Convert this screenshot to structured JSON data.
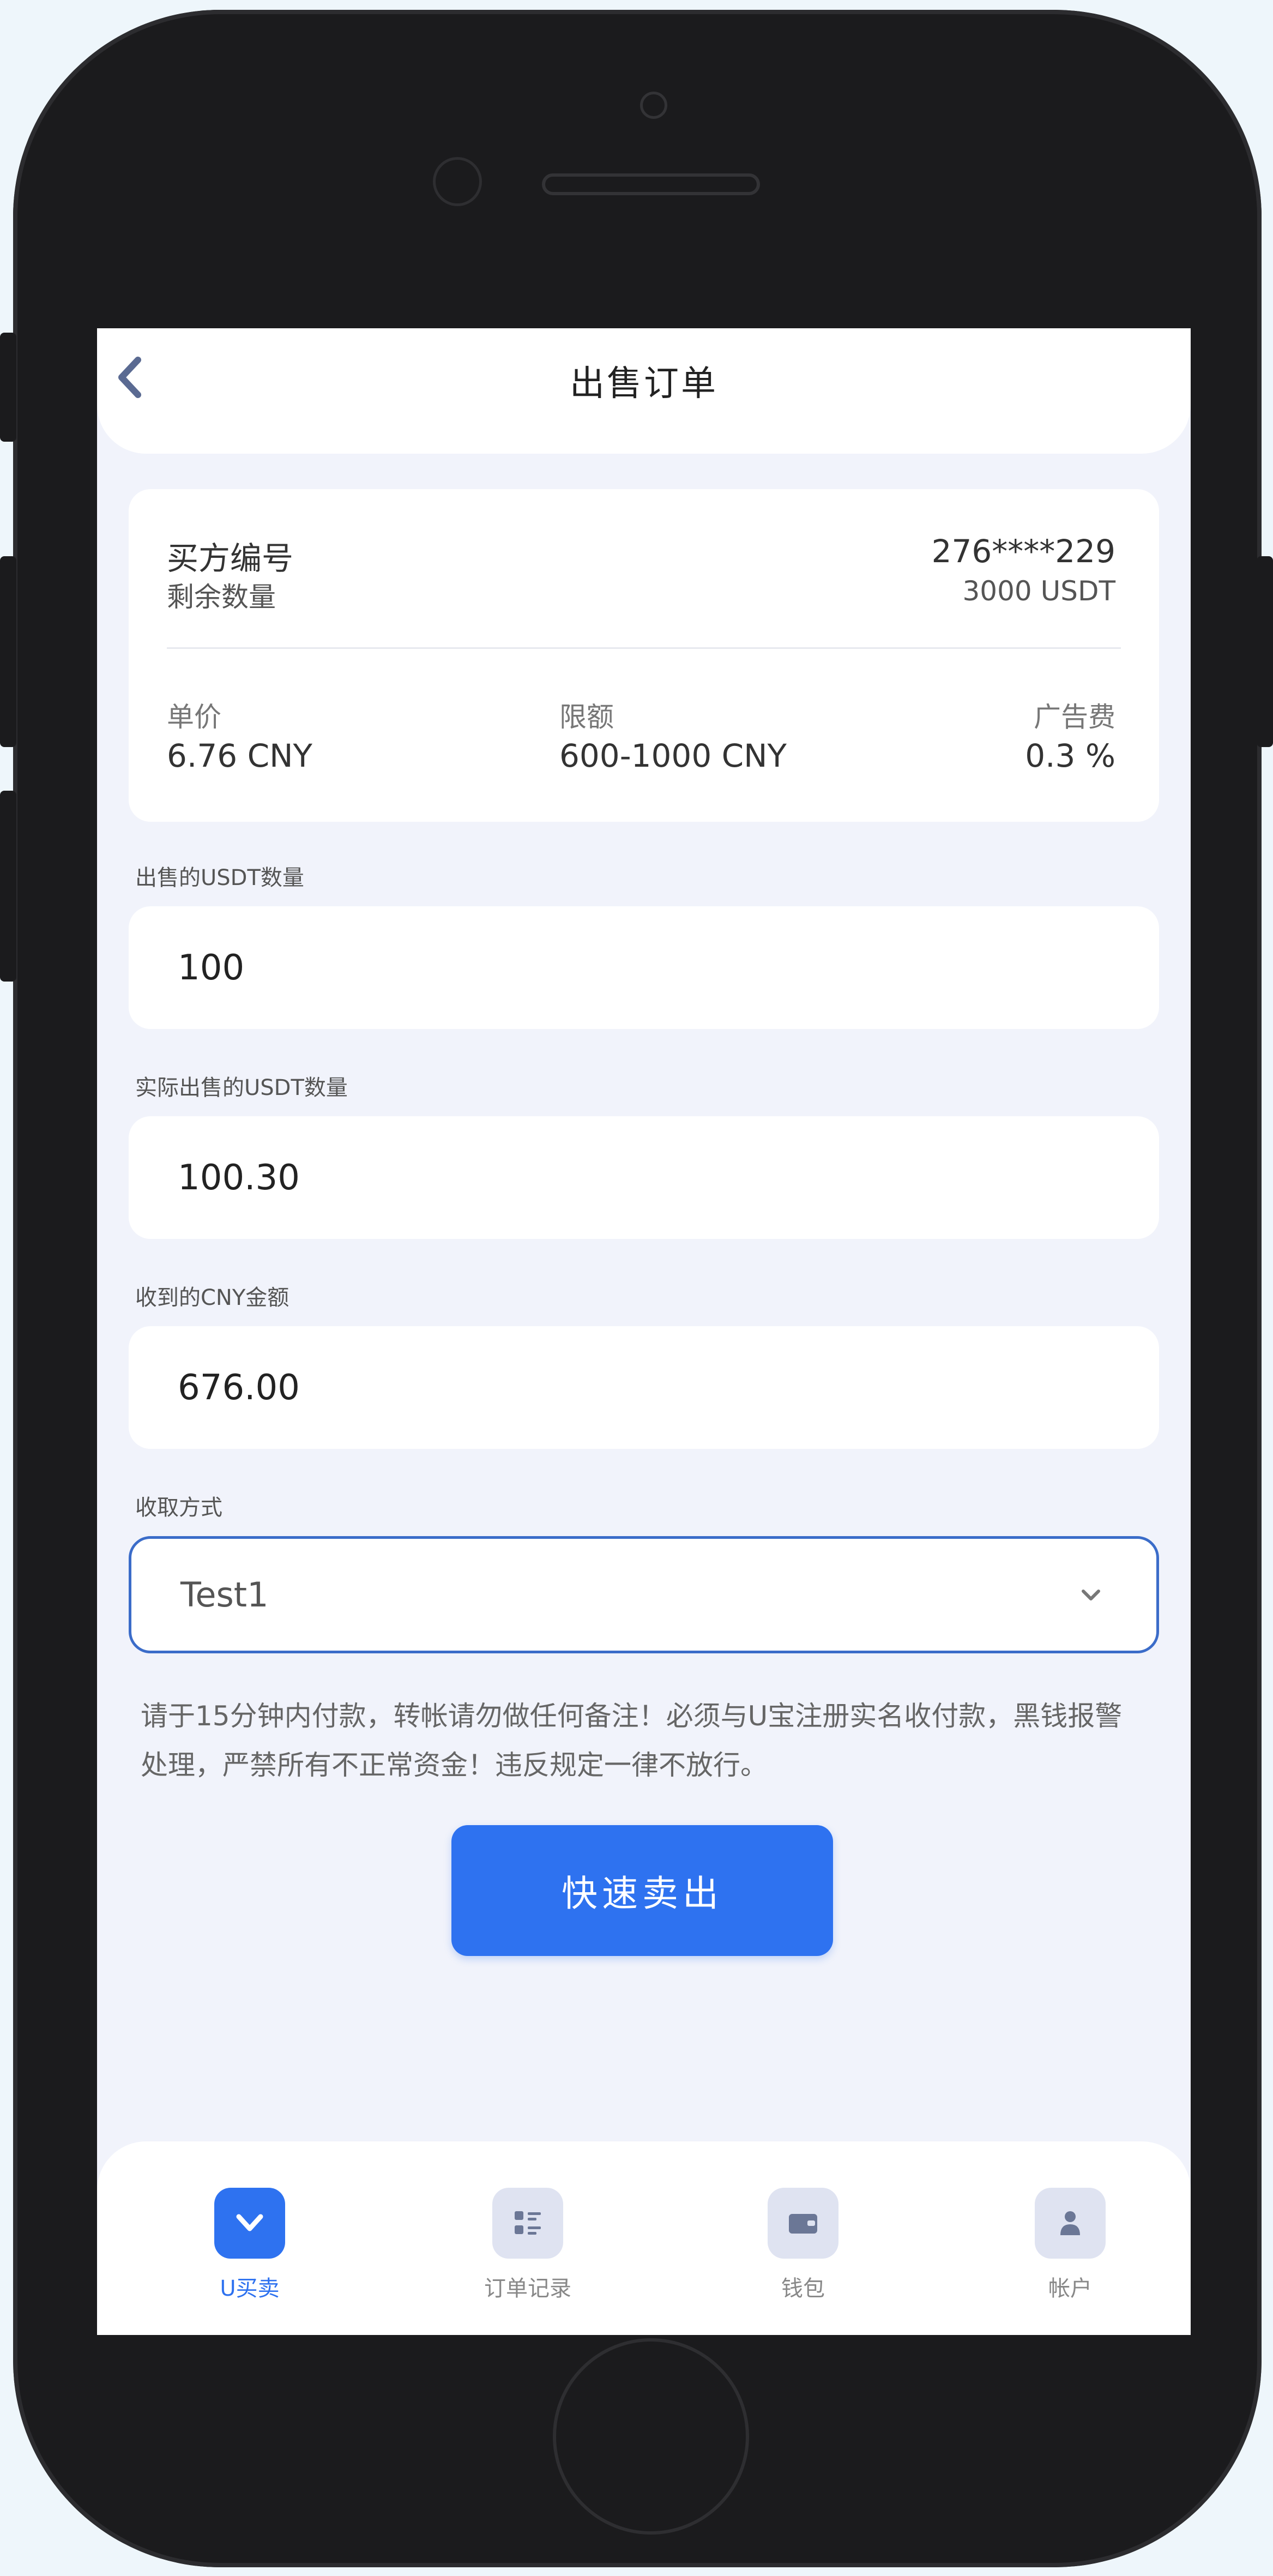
{
  "header": {
    "title": "出售订单"
  },
  "order": {
    "buyer_id_label": "买方编号",
    "buyer_id_value": "276****229",
    "remaining_label": "剩余数量",
    "remaining_value": "3000 USDT",
    "price_label": "单价",
    "price_value": "6.76 CNY",
    "limit_label": "限额",
    "limit_value": "600-1000 CNY",
    "fee_label": "广告费",
    "fee_value": "0.3 %"
  },
  "form": {
    "sell_amount_label": "出售的USDT数量",
    "sell_amount_value": "100",
    "actual_amount_label": "实际出售的USDT数量",
    "actual_amount_value": "100.30",
    "cny_amount_label": "收到的CNY金额",
    "cny_amount_value": "676.00",
    "method_label": "收取方式",
    "method_value": "Test1"
  },
  "notice": "请于15分钟内付款，转帐请勿做任何备注！必须与U宝注册实名收付款，黑钱报警处理，严禁所有不正常资金！违反规定一律不放行。",
  "submit_label": "快速卖出",
  "tabs": [
    {
      "label": "U买卖",
      "icon": "chevron-down-icon",
      "active": true
    },
    {
      "label": "订单记录",
      "icon": "order-list-icon",
      "active": false
    },
    {
      "label": "钱包",
      "icon": "wallet-icon",
      "active": false
    },
    {
      "label": "帐户",
      "icon": "user-icon",
      "active": false
    }
  ],
  "colors": {
    "accent": "#2e72f0",
    "background": "#f1f3fb",
    "select_border": "#3b6cc9"
  }
}
